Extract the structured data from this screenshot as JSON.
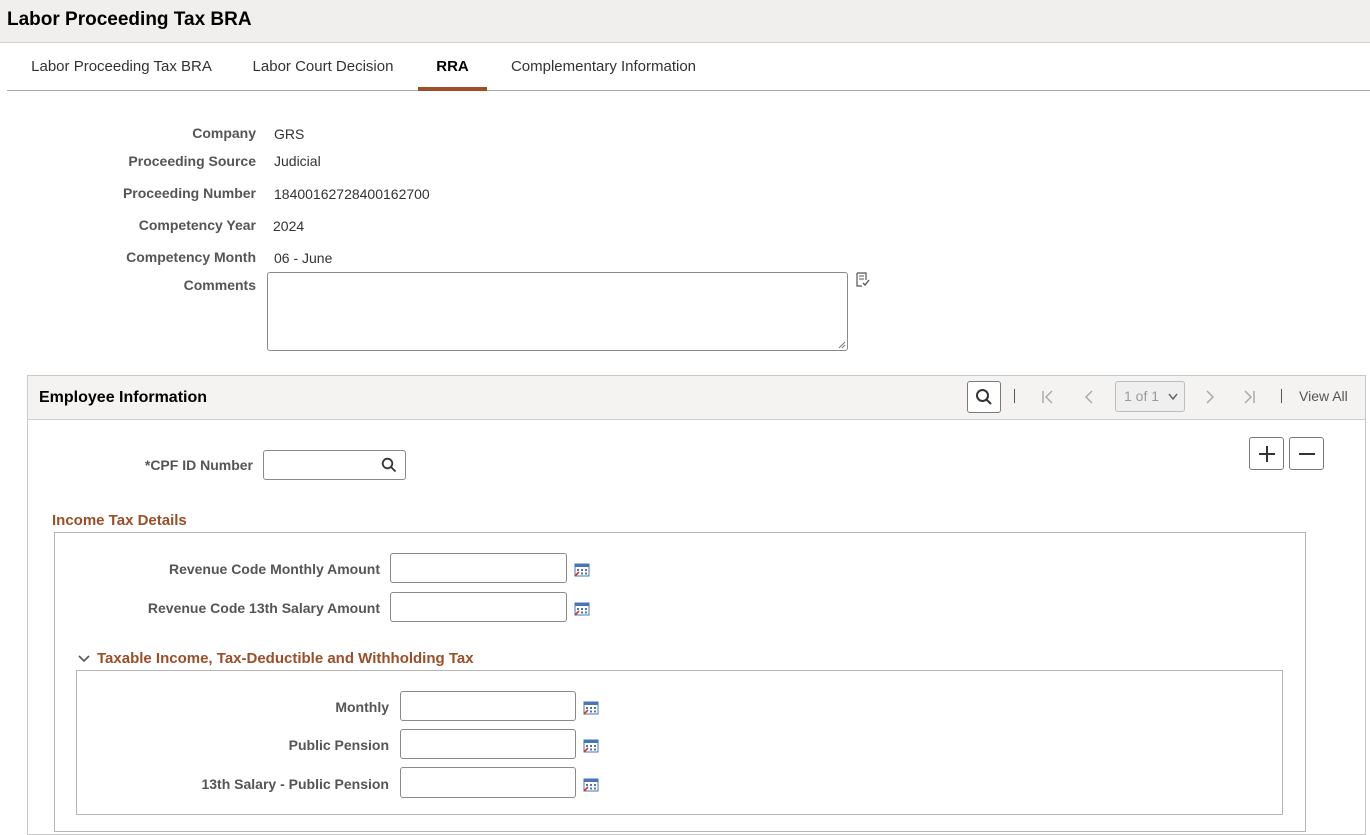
{
  "page": {
    "title": "Labor Proceeding Tax BRA"
  },
  "tabs": [
    {
      "label": "Labor Proceeding Tax BRA",
      "active": false
    },
    {
      "label": "Labor Court Decision",
      "active": false
    },
    {
      "label": "RRA",
      "active": true
    },
    {
      "label": "Complementary Information",
      "active": false
    }
  ],
  "header_fields": {
    "company": {
      "label": "Company",
      "value": "GRS"
    },
    "proceeding_source": {
      "label": "Proceeding Source",
      "value": "Judicial"
    },
    "proceeding_number": {
      "label": "Proceeding Number",
      "value": "18400162728400162700"
    },
    "competency_year": {
      "label": "Competency Year",
      "value": "2024"
    },
    "competency_month": {
      "label": "Competency Month",
      "value": "06 - June"
    },
    "comments": {
      "label": "Comments",
      "value": ""
    }
  },
  "employee": {
    "title": "Employee Information",
    "pager": "1 of 1",
    "view_all": "View All",
    "cpf": {
      "label": "*CPF ID Number",
      "value": ""
    }
  },
  "income_tax": {
    "title": "Income Tax Details",
    "revenue_monthly": {
      "label": "Revenue Code Monthly Amount",
      "value": ""
    },
    "revenue_13th": {
      "label": "Revenue Code 13th Salary Amount",
      "value": ""
    }
  },
  "taxable": {
    "title": "Taxable Income, Tax-Deductible and Withholding Tax",
    "monthly": {
      "label": "Monthly",
      "value": ""
    },
    "public_pension": {
      "label": "Public Pension",
      "value": ""
    },
    "salary13_pension": {
      "label": "13th Salary - Public Pension",
      "value": ""
    }
  },
  "colors": {
    "accent": "#9b4e28",
    "header_bg": "#f0efee"
  }
}
